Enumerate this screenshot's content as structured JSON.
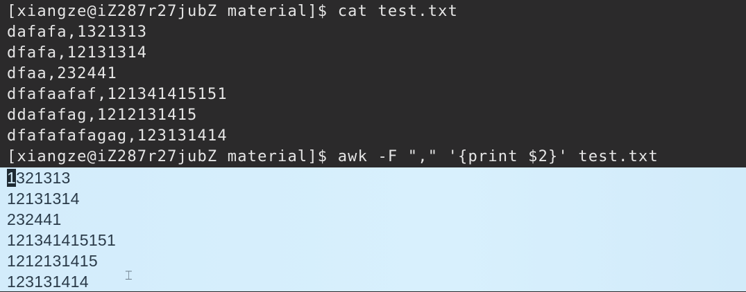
{
  "terminal": {
    "command_1": "[xiangze@iZ287r27jubZ material]$ cat test.txt",
    "file_lines": [
      "dafafa,1321313",
      "dfafa,12131314",
      "dfaa,232441",
      "dfafaafaf,121341415151",
      "ddafafag,1212131415",
      "dfafafafagag,123131414"
    ],
    "command_2": "[xiangze@iZ287r27jubZ material]$ awk -F \",\" '{print $2}' test.txt",
    "output_first_char": "1",
    "output_first_rest": "321313",
    "output_lines": [
      "12131314",
      "232441",
      "121341415151",
      "1212131415",
      "123131414"
    ]
  },
  "colors": {
    "background": "#2b2a2b",
    "selection": "#d5eefc"
  }
}
